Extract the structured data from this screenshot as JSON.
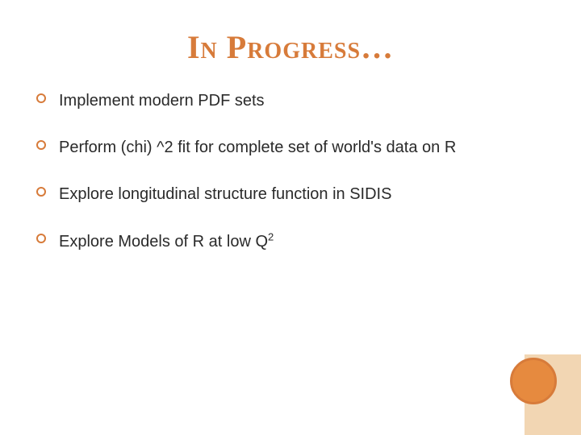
{
  "title": "In Progress…",
  "bullets": [
    {
      "text": "Implement modern PDF sets"
    },
    {
      "text": "Perform (chi) ^2 fit for complete set of world's data on R"
    },
    {
      "text": "Explore longitudinal structure function in SIDIS"
    },
    {
      "text_pre": "Explore Models of R at low Q",
      "sup": "2"
    }
  ]
}
